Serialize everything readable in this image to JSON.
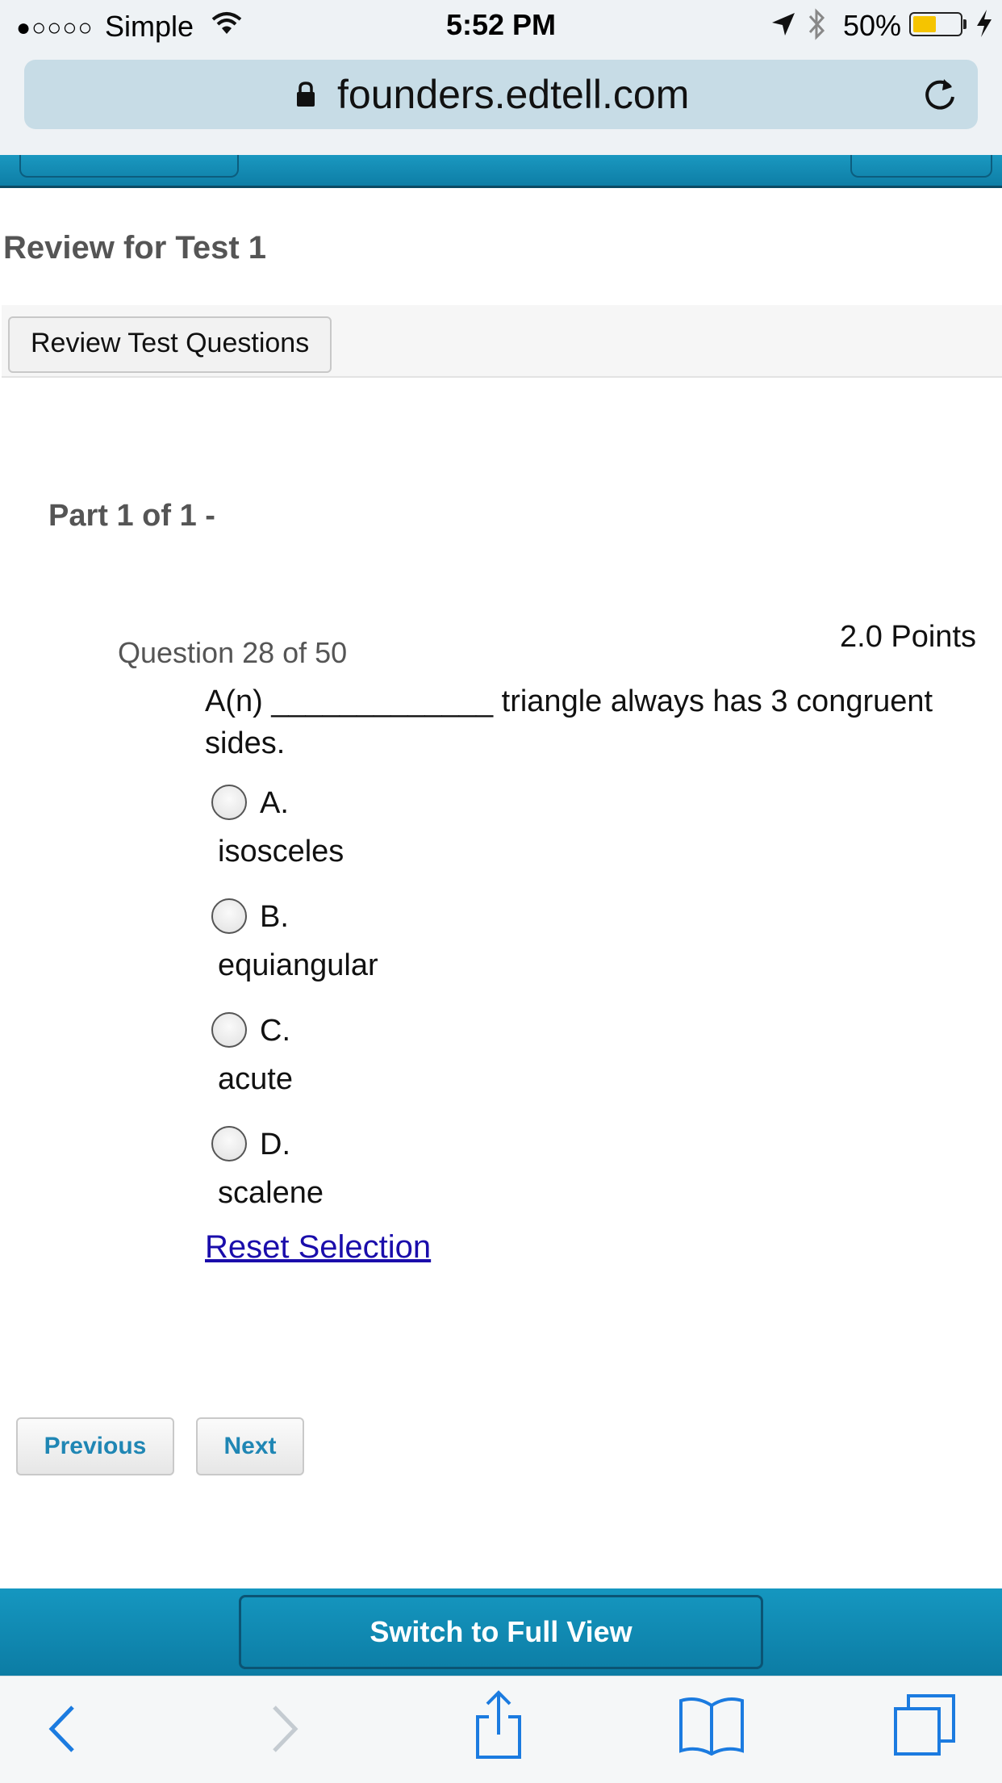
{
  "status_bar": {
    "signal": "●○○○○",
    "carrier": "Simple",
    "time": "5:52 PM",
    "battery_percent": "50%",
    "battery_level": 0.5,
    "icons": [
      "wifi-icon",
      "location-arrow-icon",
      "bluetooth-icon",
      "battery-icon",
      "charging-bolt-icon"
    ]
  },
  "browser": {
    "url": "founders.edtell.com",
    "icons": [
      "lock-icon",
      "reload-icon"
    ]
  },
  "page": {
    "title": "Review for Test 1",
    "review_button": "Review Test Questions",
    "part_label": "Part 1 of 1 -"
  },
  "question": {
    "number_text": "Question 28 of 50",
    "points": "2.0 Points",
    "text": "A(n) _____________  triangle always has 3 congruent sides.",
    "options": [
      {
        "letter": "A.",
        "text": "isosceles"
      },
      {
        "letter": "B.",
        "text": "equiangular"
      },
      {
        "letter": "C.",
        "text": "acute"
      },
      {
        "letter": "D.",
        "text": "scalene"
      }
    ],
    "reset_label": "Reset Selection"
  },
  "navigation": {
    "previous": "Previous",
    "next": "Next"
  },
  "footer": {
    "full_view": "Switch to Full View"
  },
  "safari_toolbar": {
    "icons": [
      "back-chevron-icon",
      "forward-chevron-icon",
      "share-icon",
      "bookmarks-icon",
      "tabs-icon"
    ]
  },
  "colors": {
    "header_blue": "#1597c0",
    "link_blue": "#1a0dab",
    "nav_button_text": "#1f86b4",
    "battery_yellow": "#f5c400"
  }
}
